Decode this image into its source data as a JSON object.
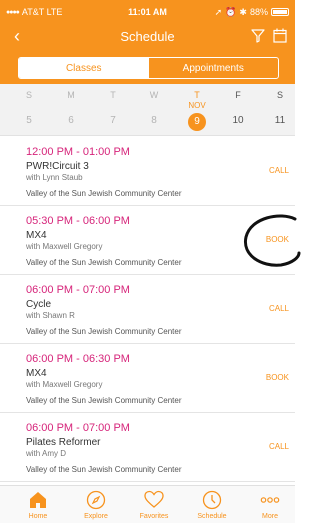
{
  "status_bar": {
    "carrier": "AT&T LTE",
    "time": "11:01 AM",
    "battery": "88%"
  },
  "nav": {
    "back_icon": "chevron-left-icon",
    "title": "Schedule",
    "filter_icon": "filter-icon",
    "calendar_icon": "calendar-icon"
  },
  "segments": {
    "classes": "Classes",
    "appointments": "Appointments",
    "selected": "Classes"
  },
  "week": {
    "month_label": "NOV",
    "days": [
      {
        "name": "S",
        "date": "5"
      },
      {
        "name": "M",
        "date": "6"
      },
      {
        "name": "T",
        "date": "7"
      },
      {
        "name": "W",
        "date": "8"
      },
      {
        "name": "T",
        "date": "9"
      },
      {
        "name": "F",
        "date": "10"
      },
      {
        "name": "S",
        "date": "11"
      }
    ],
    "selected_index": 4
  },
  "classes": [
    {
      "time": "12:00 PM - 01:00 PM",
      "name": "PWR!Circuit 3",
      "instructor": "with Lynn Staub",
      "location": "Valley of the Sun Jewish Community Center",
      "action": "CALL"
    },
    {
      "time": "05:30 PM - 06:00 PM",
      "name": "MX4",
      "instructor": "with Maxwell Gregory",
      "location": "Valley of the Sun Jewish Community Center",
      "action": "BOOK"
    },
    {
      "time": "06:00 PM - 07:00 PM",
      "name": "Cycle",
      "instructor": "with Shawn R",
      "location": "Valley of the Sun Jewish Community Center",
      "action": "CALL"
    },
    {
      "time": "06:00 PM - 06:30 PM",
      "name": "MX4",
      "instructor": "with Maxwell Gregory",
      "location": "Valley of the Sun Jewish Community Center",
      "action": "BOOK"
    },
    {
      "time": "06:00 PM - 07:00 PM",
      "name": "Pilates Reformer",
      "instructor": "with Amy D",
      "location": "Valley of the Sun Jewish Community Center",
      "action": "CALL"
    }
  ],
  "tabs": [
    {
      "label": "Home",
      "icon": "home-icon"
    },
    {
      "label": "Explore",
      "icon": "compass-icon"
    },
    {
      "label": "Favorites",
      "icon": "heart-icon"
    },
    {
      "label": "Schedule",
      "icon": "clock-icon"
    },
    {
      "label": "More",
      "icon": "more-icon"
    }
  ],
  "colors": {
    "accent": "#f7931e",
    "time_text": "#d6247a"
  }
}
